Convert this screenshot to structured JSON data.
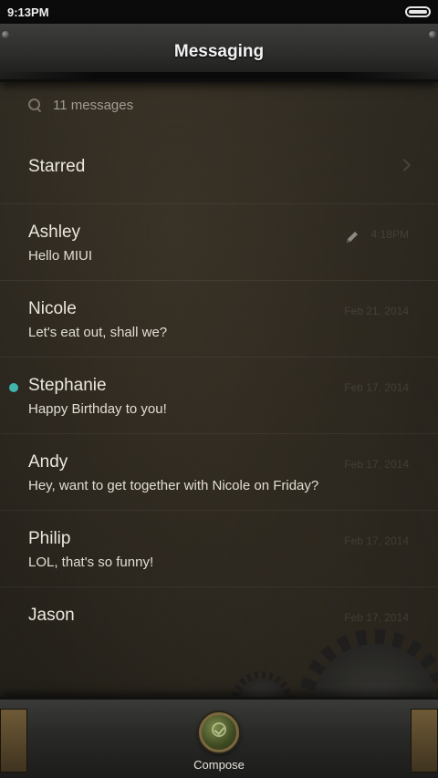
{
  "status_bar": {
    "time": "9:13PM"
  },
  "header": {
    "title": "Messaging"
  },
  "search": {
    "count_text": "11 messages"
  },
  "starred": {
    "label": "Starred"
  },
  "messages": [
    {
      "name": "Ashley",
      "preview": "Hello MIUI",
      "date": "4:18PM",
      "unread": false,
      "draft": true
    },
    {
      "name": "Nicole",
      "preview": "Let's eat out, shall we?",
      "date": "Feb 21, 2014",
      "unread": false,
      "draft": false
    },
    {
      "name": "Stephanie",
      "preview": "Happy Birthday to you!",
      "date": "Feb 17, 2014",
      "unread": true,
      "draft": false
    },
    {
      "name": "Andy",
      "preview": "Hey, want to get together with Nicole on Friday?",
      "date": "Feb 17, 2014",
      "unread": false,
      "draft": false
    },
    {
      "name": "Philip",
      "preview": "LOL, that's so funny!",
      "date": "Feb 17, 2014",
      "unread": false,
      "draft": false
    },
    {
      "name": "Jason",
      "preview": "",
      "date": "Feb 17, 2014",
      "unread": false,
      "draft": false
    }
  ],
  "bottom_bar": {
    "compose_label": "Compose"
  },
  "colors": {
    "unread_dot": "#3fb5ae",
    "compose_button": "#5a6a30"
  }
}
